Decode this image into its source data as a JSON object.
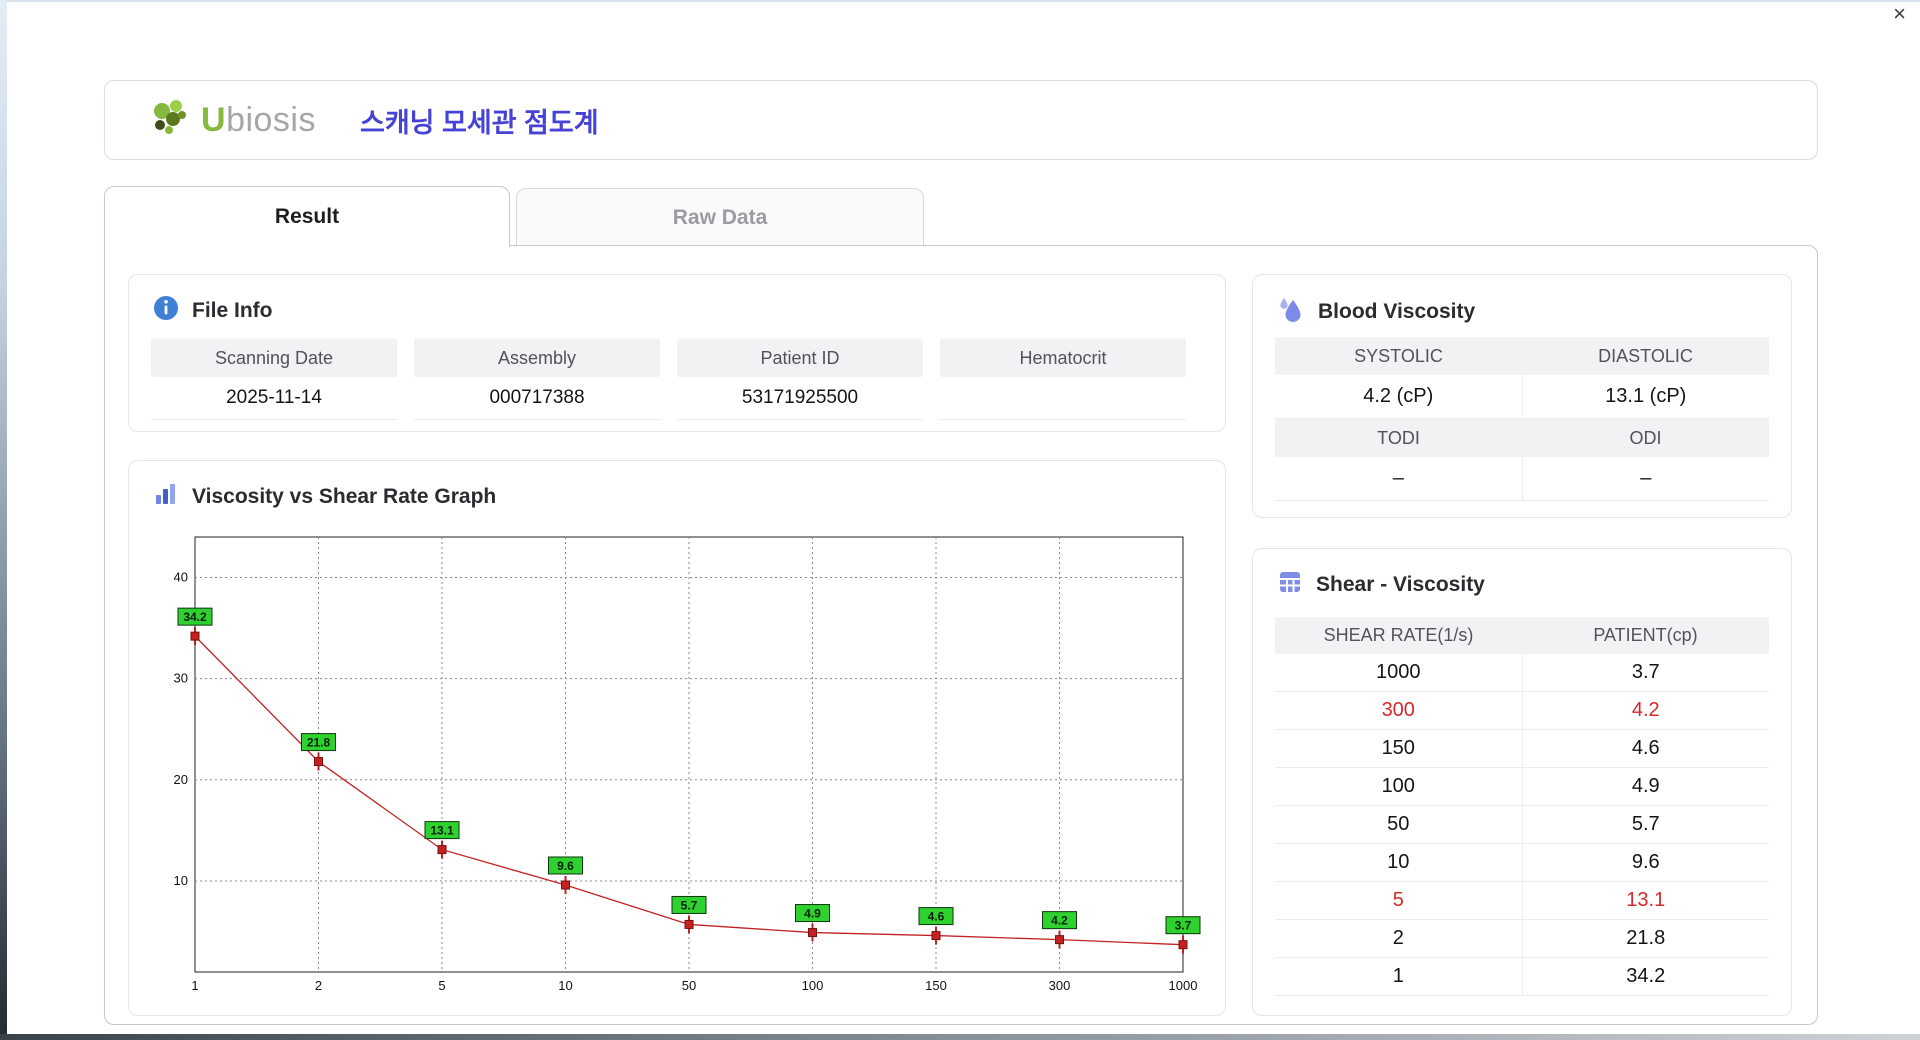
{
  "window": {
    "close_icon": "×"
  },
  "header": {
    "logo_u": "U",
    "logo_rest": "biosis",
    "title": "스캐닝 모세관 점도계"
  },
  "tabs": {
    "result": "Result",
    "raw_data": "Raw Data"
  },
  "file_info": {
    "title": "File Info",
    "fields": [
      {
        "label": "Scanning Date",
        "value": "2025-11-14"
      },
      {
        "label": "Assembly",
        "value": "000717388"
      },
      {
        "label": "Patient ID",
        "value": "53171925500"
      },
      {
        "label": "Hematocrit",
        "value": ""
      }
    ]
  },
  "blood_viscosity": {
    "title": "Blood Viscosity",
    "cells": [
      {
        "label": "SYSTOLIC",
        "value": "4.2 (cP)"
      },
      {
        "label": "DIASTOLIC",
        "value": "13.1 (cP)"
      },
      {
        "label": "TODI",
        "value": "–"
      },
      {
        "label": "ODI",
        "value": "–"
      }
    ]
  },
  "graph": {
    "title": "Viscosity vs Shear Rate Graph"
  },
  "chart_data": {
    "type": "line",
    "title": "Viscosity vs Shear Rate Graph",
    "x_scale": "category",
    "x_categories": [
      "1",
      "2",
      "5",
      "10",
      "50",
      "100",
      "150",
      "300",
      "1000"
    ],
    "values": [
      34.2,
      21.8,
      13.1,
      9.6,
      5.7,
      4.9,
      4.6,
      4.2,
      3.7
    ],
    "y_ticks": [
      10,
      20,
      30,
      40
    ],
    "ylim": [
      1,
      44
    ],
    "xlabel": "",
    "ylabel": "",
    "grid": "dotted",
    "legend": "none",
    "line_color": "#c22222",
    "marker": "red-square-with-stem",
    "label_bg": "#2fd12f",
    "label_border": "#0c360c"
  },
  "shear_viscosity": {
    "title": "Shear - Viscosity",
    "columns": [
      "SHEAR RATE(1/s)",
      "PATIENT(cp)"
    ],
    "rows": [
      {
        "shear": "1000",
        "patient": "3.7",
        "highlight": false
      },
      {
        "shear": "300",
        "patient": "4.2",
        "highlight": true
      },
      {
        "shear": "150",
        "patient": "4.6",
        "highlight": false
      },
      {
        "shear": "100",
        "patient": "4.9",
        "highlight": false
      },
      {
        "shear": "50",
        "patient": "5.7",
        "highlight": false
      },
      {
        "shear": "10",
        "patient": "9.6",
        "highlight": false
      },
      {
        "shear": "5",
        "patient": "13.1",
        "highlight": true
      },
      {
        "shear": "2",
        "patient": "21.8",
        "highlight": false
      },
      {
        "shear": "1",
        "patient": "34.2",
        "highlight": false
      }
    ]
  },
  "colors": {
    "accent_blue_title": "#4742d6",
    "logo_green": "#86b93c",
    "info_icon_blue": "#3f7fd6",
    "purple_icon": "#7f8ce8",
    "bar_icon_blue": "#3f62c8",
    "table_red": "#d42a2a",
    "chart_line_red": "#c22222",
    "chart_label_green": "#2fd12f",
    "header_gray": "#f2f2f5"
  }
}
